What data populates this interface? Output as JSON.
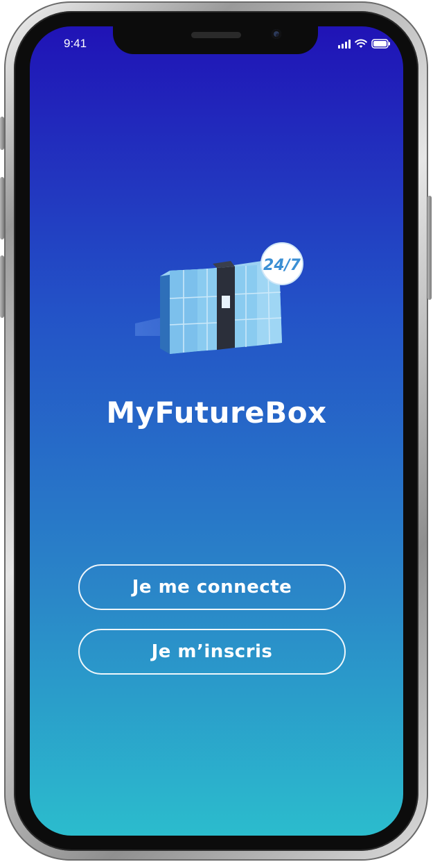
{
  "status_bar": {
    "time": "9:41",
    "icons": [
      "signal-icon",
      "wifi-icon",
      "battery-icon"
    ]
  },
  "app": {
    "title": "MyFutureBox",
    "badge_text": "24/7",
    "illustration": "parcel-locker-illustration"
  },
  "actions": {
    "login_label": "Je me connecte",
    "signup_label": "Je m’inscris"
  },
  "colors": {
    "gradient_top": "#2013b6",
    "gradient_bottom": "#2bbccd",
    "text": "#ffffff"
  }
}
